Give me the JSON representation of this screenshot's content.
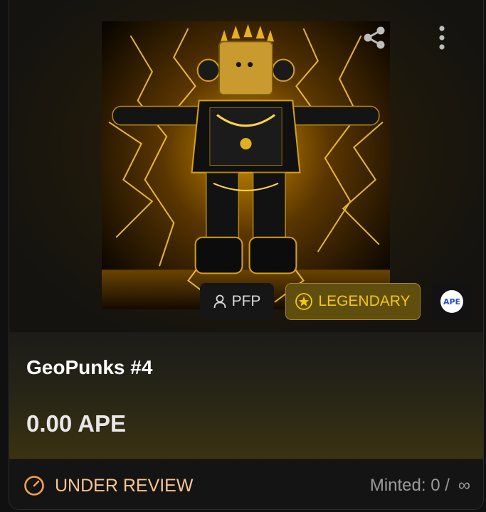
{
  "nft": {
    "title": "GeoPunks #4",
    "price": "0.00 APE",
    "category_tag": {
      "label": "PFP",
      "icon": "person-icon"
    },
    "rarity_tag": {
      "label": "LEGENDARY",
      "icon": "star-icon"
    },
    "chain_logo_text": "APE",
    "artwork_description_icon": "nft-artwork-image"
  },
  "actions": {
    "share_icon": "share-icon",
    "menu_icon": "kebab-menu-icon"
  },
  "footer": {
    "status": "UNDER REVIEW",
    "status_icon": "gauge-icon",
    "minted_label": "Minted: 0 /",
    "minted_limit": "∞"
  },
  "colors": {
    "rarity_gold": "#f5c518",
    "status_orange": "#f7a04b",
    "status_text": "#f7c590",
    "chain_blue": "#1f4fd6"
  }
}
